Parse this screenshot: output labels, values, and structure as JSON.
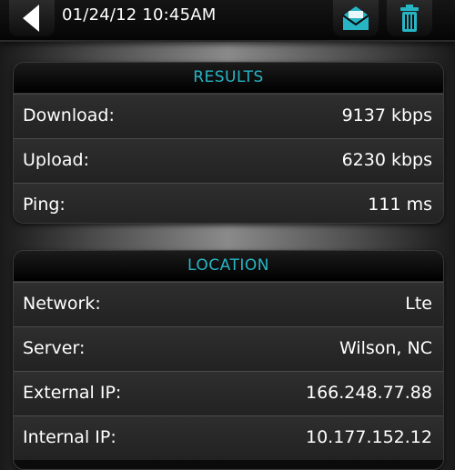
{
  "toolbar": {
    "timestamp": "01/24/12 10:45AM",
    "icons": {
      "back": "back-arrow-icon",
      "mail": "mail-icon",
      "trash": "trash-icon"
    },
    "accent_color": "#27b5c4"
  },
  "results": {
    "title": "RESULTS",
    "rows": [
      {
        "label": "Download:",
        "value": "9137 kbps"
      },
      {
        "label": "Upload:",
        "value": "6230 kbps"
      },
      {
        "label": "Ping:",
        "value": "111 ms"
      }
    ]
  },
  "location": {
    "title": "LOCATION",
    "rows": [
      {
        "label": "Network:",
        "value": "Lte"
      },
      {
        "label": "Server:",
        "value": "Wilson, NC"
      },
      {
        "label": "External IP:",
        "value": "166.248.77.88"
      },
      {
        "label": "Internal IP:",
        "value": "10.177.152.12"
      }
    ]
  }
}
